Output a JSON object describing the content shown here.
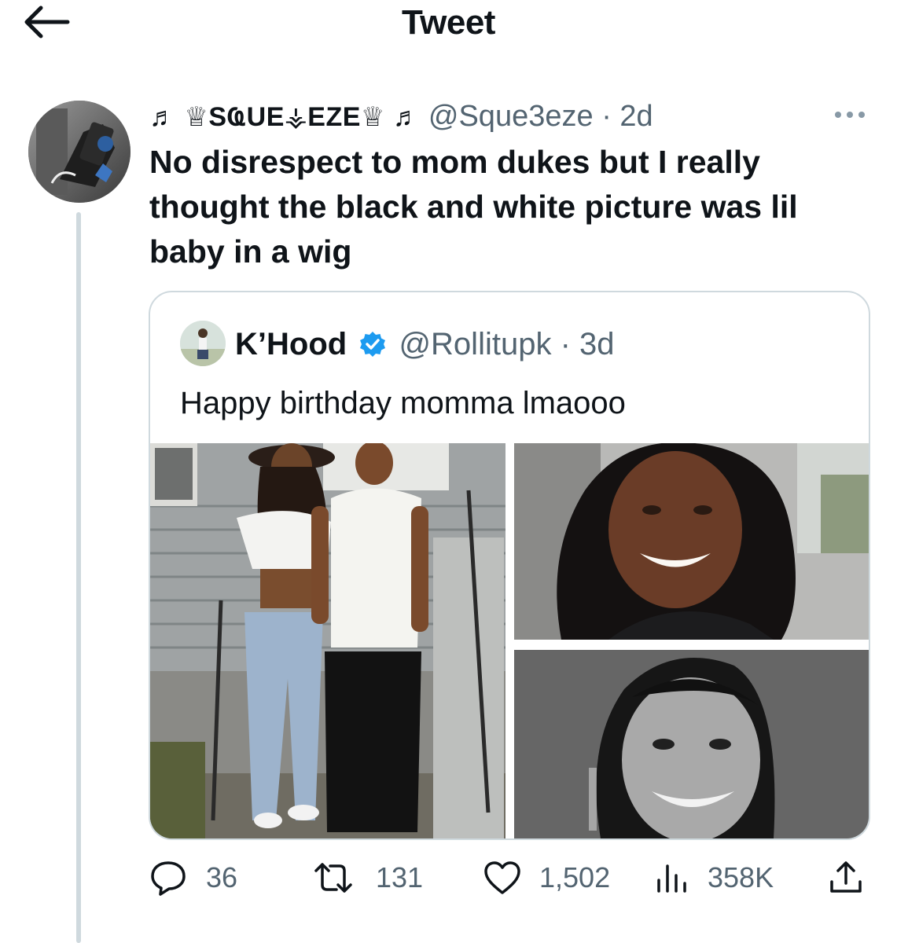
{
  "header": {
    "title": "Tweet",
    "back_icon": "arrow-left-icon"
  },
  "tweet": {
    "display_name": "♬ ♕SҨUE⚶EZE♕ ♬",
    "handle": "@Sque3eze",
    "separator": "·",
    "time": "2d",
    "text": "No disrespect to mom dukes but I really thought the black and white picture was lil baby in a wig",
    "more_icon": "more-horizontal-icon"
  },
  "quoted": {
    "display_name": "K’Hood",
    "handle": "@Rollitupk",
    "separator": "·",
    "time": "3d",
    "text": "Happy birthday momma lmaooo",
    "verified": true,
    "media": [
      {
        "name": "two-women-outdoor-photo",
        "tone": "color"
      },
      {
        "name": "woman-car-selfie-photo",
        "tone": "color"
      },
      {
        "name": "black-and-white-portrait-photo",
        "tone": "grayscale"
      }
    ]
  },
  "actions": {
    "replies": "36",
    "retweets": "131",
    "likes": "1,502",
    "views": "358K"
  },
  "colors": {
    "text": "#0f1419",
    "secondary": "#536471",
    "border": "#cfd9de",
    "verified": "#1d9bf0"
  }
}
